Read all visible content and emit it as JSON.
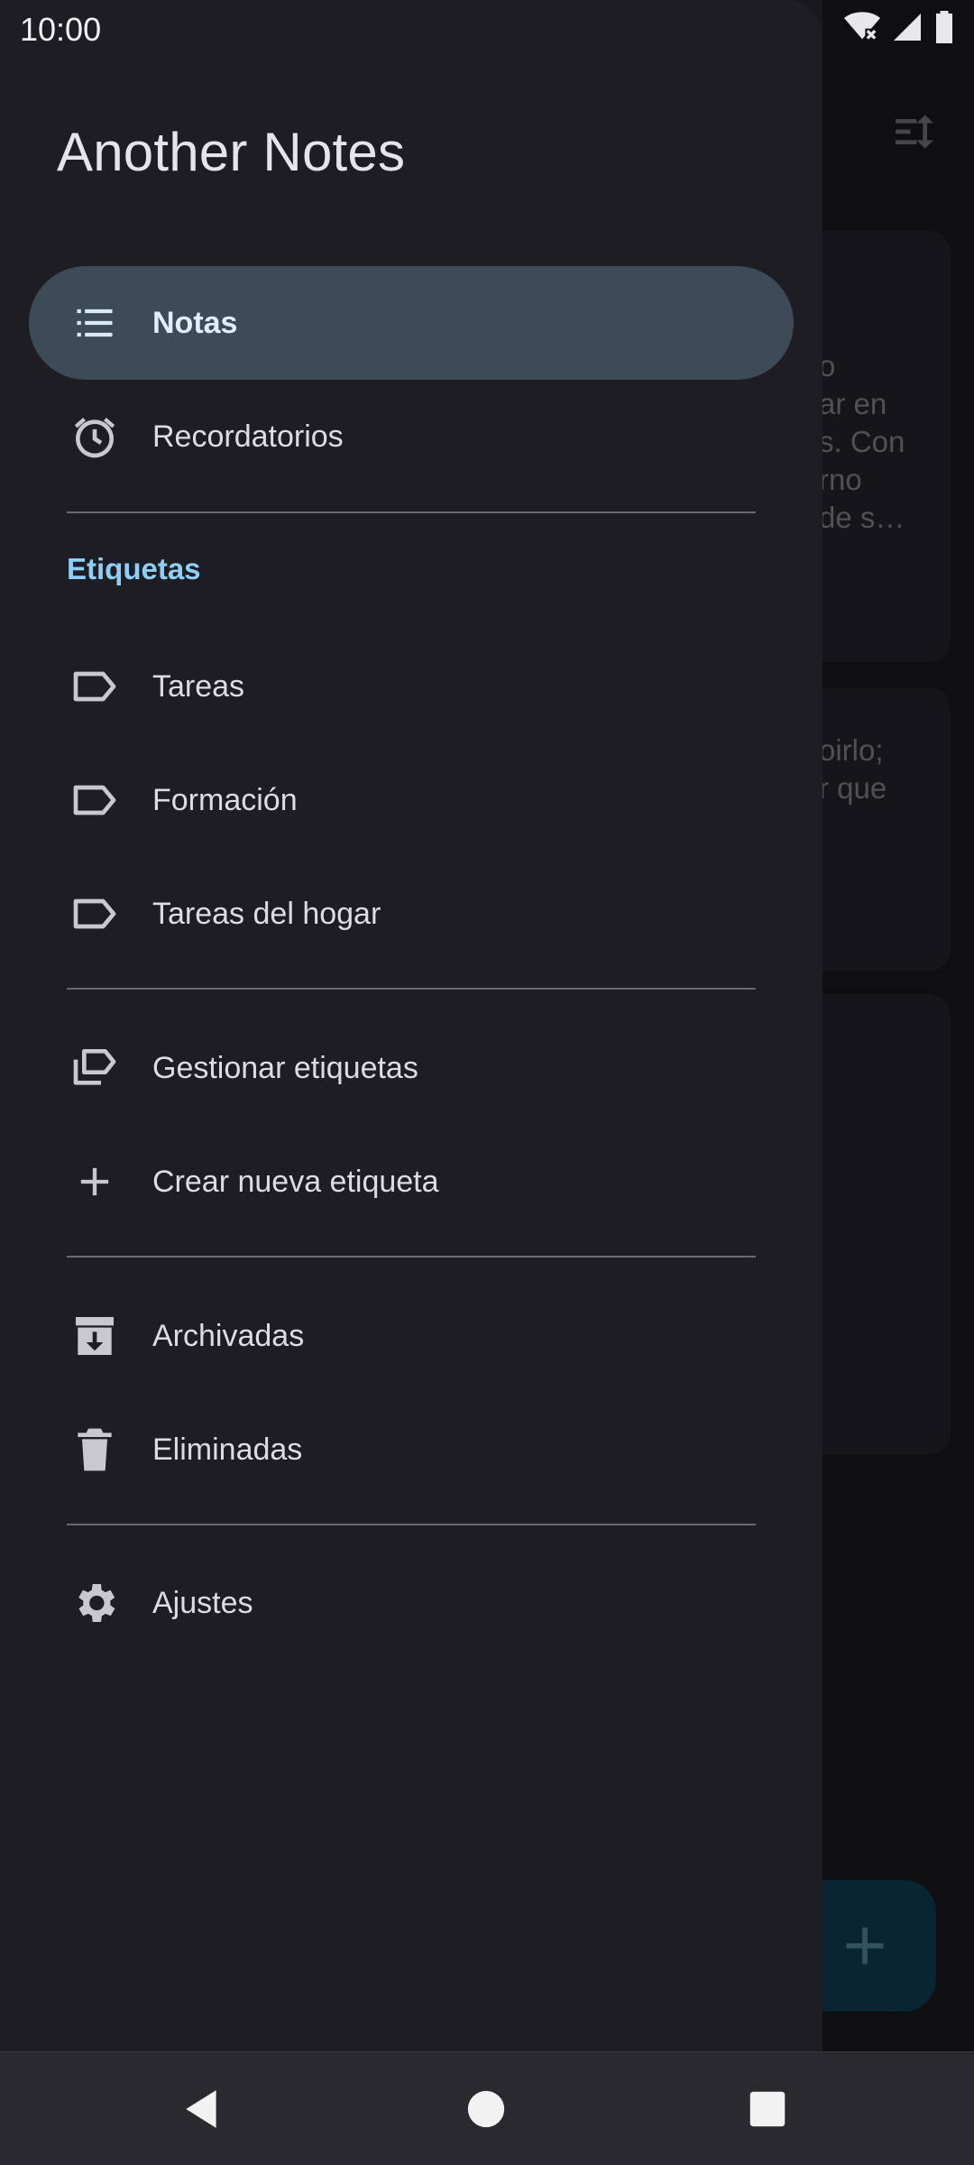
{
  "status_bar": {
    "time": "10:00",
    "icons": [
      "wifi-off-icon",
      "signal-icon",
      "battery-icon"
    ]
  },
  "drawer": {
    "title": "Another Notes",
    "primary": [
      {
        "label": "Notas",
        "icon": "list-icon",
        "active": true
      },
      {
        "label": "Recordatorios",
        "icon": "alarm-icon",
        "active": false
      }
    ],
    "labels_header": "Etiquetas",
    "labels": [
      {
        "label": "Tareas",
        "icon": "label-icon"
      },
      {
        "label": "Formación",
        "icon": "label-icon"
      },
      {
        "label": "Tareas del hogar",
        "icon": "label-icon"
      }
    ],
    "label_actions": [
      {
        "label": "Gestionar etiquetas",
        "icon": "manage-labels-icon"
      },
      {
        "label": "Crear nueva etiqueta",
        "icon": "plus-icon"
      }
    ],
    "folders": [
      {
        "label": "Archivadas",
        "icon": "archive-icon"
      },
      {
        "label": "Eliminadas",
        "icon": "trash-icon"
      }
    ],
    "settings": {
      "label": "Ajustes",
      "icon": "gear-icon"
    }
  },
  "background": {
    "cards": [
      {
        "lines": [
          "o",
          "ar en",
          "s. Con",
          "rno",
          "de s…"
        ]
      },
      {
        "lines": [
          "oirlo;",
          "r que"
        ]
      },
      {
        "lines": []
      }
    ],
    "fab_icon": "plus-icon"
  },
  "colors": {
    "drawer_bg": "#1e1d23",
    "active_item_bg": "#3d4a57",
    "accent": "#8fcff7"
  }
}
